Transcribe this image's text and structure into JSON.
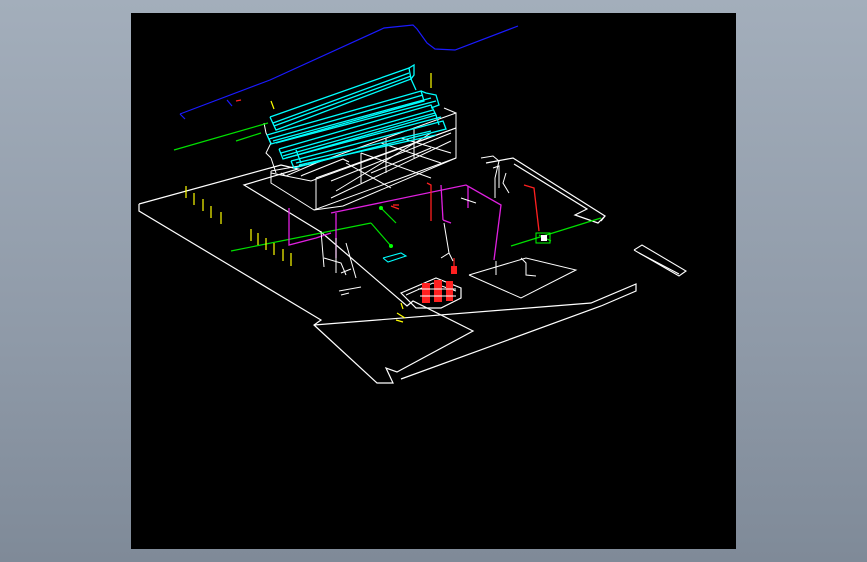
{
  "viewer": {
    "background": "#000000",
    "frame_color": "#9aa5b2"
  },
  "layers": {
    "walls": "#ffffff",
    "ductwork": "#00ffff",
    "pipes_blue": "#1a1aff",
    "pipes_green": "#00e000",
    "pipes_magenta": "#e020e0",
    "pipes_red": "#ff2020",
    "markers_yellow": "#ffff00"
  }
}
